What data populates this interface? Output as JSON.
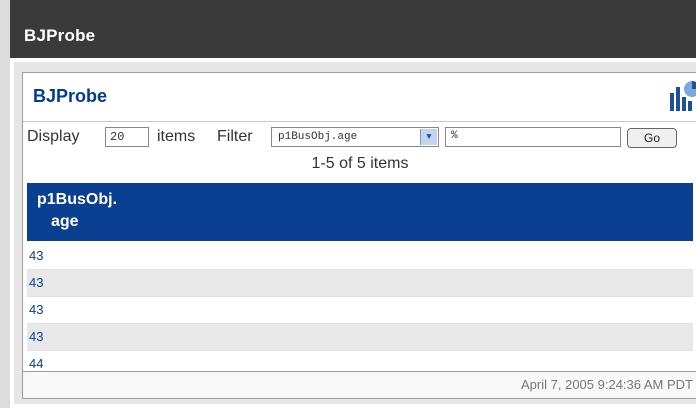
{
  "window": {
    "title": "BJProbe"
  },
  "panel": {
    "title": "BJProbe",
    "icon": "chart-icon"
  },
  "controls": {
    "display_label": "Display",
    "display_value": "20",
    "items_label": "items",
    "filter_label": "Filter",
    "filter_field": "p1BusObj.age",
    "filter_value": "%",
    "go_label": "Go"
  },
  "pager": {
    "text": "1-5 of 5 items"
  },
  "table": {
    "header_line1": "p1BusObj.",
    "header_line2": "age",
    "rows": [
      "43",
      "43",
      "43",
      "43",
      "44"
    ]
  },
  "footer": {
    "timestamp": "April 7, 2005 9:24:36 AM PDT"
  },
  "colors": {
    "title_bar": "#3a3a3a",
    "header_bg": "#0b3f91",
    "link": "#0b3f91"
  }
}
